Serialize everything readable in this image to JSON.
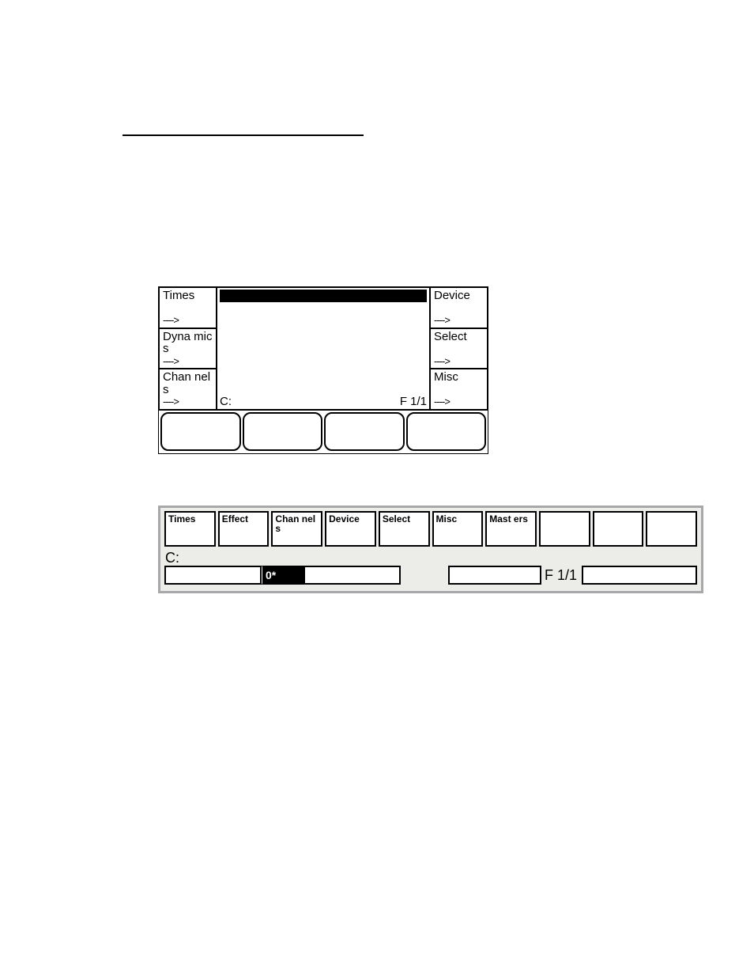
{
  "panel1": {
    "left": [
      {
        "label": "Times",
        "arrow": "---->"
      },
      {
        "label": "Dyna mics",
        "arrow": "---->"
      },
      {
        "label": "Chan nels",
        "arrow": "---->"
      }
    ],
    "right": [
      {
        "label": "Device",
        "arrow": "---->"
      },
      {
        "label": "Select",
        "arrow": "---->"
      },
      {
        "label": "Misc",
        "arrow": "---->"
      }
    ],
    "center": {
      "left_label": "C:",
      "right_label": "F  1/1"
    }
  },
  "panel2": {
    "top_buttons": [
      "Times",
      "Effect",
      "Chan nels",
      "Device",
      "Select",
      "Misc",
      "Mast ers",
      "",
      "",
      ""
    ],
    "c_label": "C:",
    "zero_label": "0*",
    "f_label": "F 1/1"
  }
}
